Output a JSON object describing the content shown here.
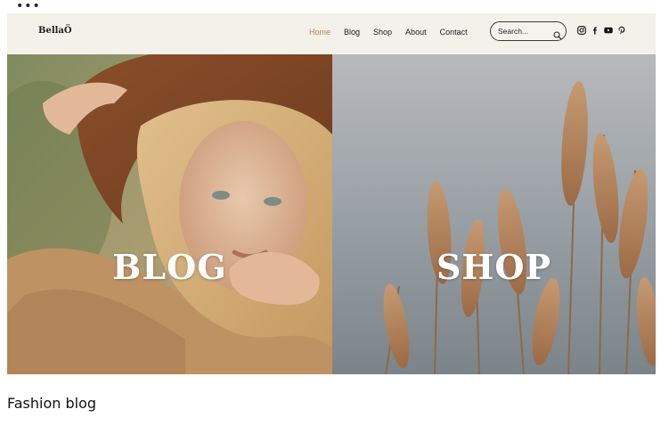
{
  "menu_dots": "•••",
  "site": {
    "logo": "BellaÖ",
    "nav": [
      "Home",
      "Blog",
      "Shop",
      "About",
      "Contact"
    ],
    "active_nav": "Home",
    "search": {
      "placeholder": "Search..."
    },
    "social_icons": [
      "instagram-icon",
      "facebook-icon",
      "youtube-icon",
      "pinterest-icon"
    ],
    "colors": {
      "accent": "#b4894f",
      "header_bg": "#f4f0ea"
    }
  },
  "panels": {
    "blog_label": "BLOG",
    "shop_label": "SHOP"
  },
  "caption": "Fashion blog"
}
